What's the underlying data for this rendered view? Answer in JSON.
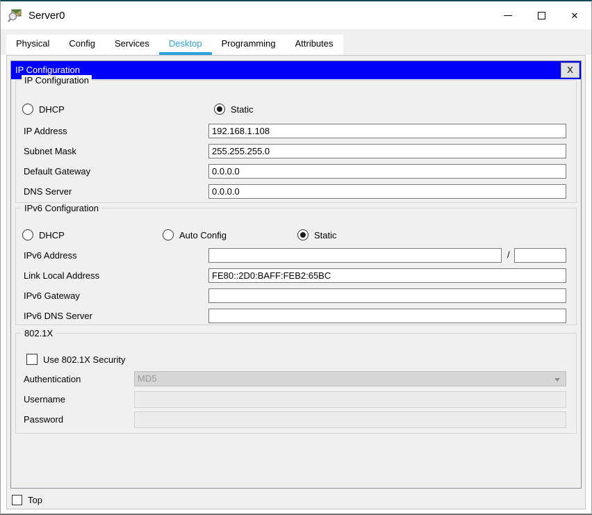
{
  "window": {
    "title": "Server0",
    "close_glyph": "✕"
  },
  "tabs": [
    {
      "label": "Physical",
      "active": false
    },
    {
      "label": "Config",
      "active": false
    },
    {
      "label": "Services",
      "active": false
    },
    {
      "label": "Desktop",
      "active": true
    },
    {
      "label": "Programming",
      "active": false
    },
    {
      "label": "Attributes",
      "active": false
    }
  ],
  "dialog": {
    "title": "IP Configuration",
    "close_label": "X"
  },
  "ip_config": {
    "legend": "IP Configuration",
    "radios": [
      {
        "label": "DHCP",
        "selected": false
      },
      {
        "label": "Static",
        "selected": true
      }
    ],
    "fields": [
      {
        "label": "IP Address",
        "value": "192.168.1.108"
      },
      {
        "label": "Subnet Mask",
        "value": "255.255.255.0"
      },
      {
        "label": "Default Gateway",
        "value": "0.0.0.0"
      },
      {
        "label": "DNS Server",
        "value": "0.0.0.0"
      }
    ]
  },
  "ipv6_config": {
    "legend": "IPv6 Configuration",
    "radios": [
      {
        "label": "DHCP",
        "selected": false
      },
      {
        "label": "Auto Config",
        "selected": false
      },
      {
        "label": "Static",
        "selected": true
      }
    ],
    "address": {
      "label": "IPv6 Address",
      "value": "",
      "separator": "/",
      "prefix_value": ""
    },
    "fields": [
      {
        "label": "Link Local Address",
        "value": "FE80::2D0:BAFF:FEB2:65BC"
      },
      {
        "label": "IPv6 Gateway",
        "value": ""
      },
      {
        "label": "IPv6 DNS Server",
        "value": ""
      }
    ]
  },
  "dot1x": {
    "legend": "802.1X",
    "security_checkbox": {
      "label": "Use 802.1X Security",
      "checked": false
    },
    "authentication": {
      "label": "Authentication",
      "value": "MD5",
      "enabled": false
    },
    "username": {
      "label": "Username",
      "value": "",
      "enabled": false
    },
    "password": {
      "label": "Password",
      "value": "",
      "enabled": false
    }
  },
  "footer": {
    "top_checkbox": {
      "label": "Top",
      "checked": false
    }
  },
  "colors": {
    "dialog_titlebar": "#0000fa",
    "active_tab": "#29a3dc",
    "window_top_border": "#10485a"
  }
}
